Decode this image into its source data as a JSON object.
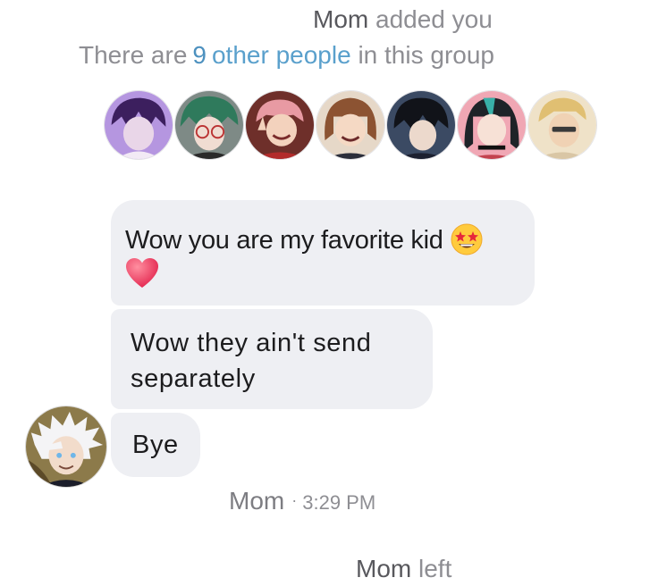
{
  "system_added": {
    "actor": "Mom",
    "action": "added you"
  },
  "group_info": {
    "prefix": "There are",
    "count": "9",
    "link": "other people",
    "suffix": "in this group"
  },
  "member_avatars": [
    {
      "icon": "purple-hair-character-avatar",
      "bg": "#8e5fc4"
    },
    {
      "icon": "green-hair-glasses-character-avatar",
      "bg": "#6d7d72"
    },
    {
      "icon": "pink-hair-peace-sign-character-avatar",
      "bg": "#b44a3c"
    },
    {
      "icon": "brown-hair-character-avatar",
      "bg": "#8b5e45"
    },
    {
      "icon": "black-hair-character-avatar",
      "bg": "#2f3a4c"
    },
    {
      "icon": "teal-hair-character-avatar",
      "bg": "#d9607a"
    },
    {
      "icon": "blonde-hair-character-avatar",
      "bg": "#e8c98e"
    }
  ],
  "messages": [
    {
      "text": "Wow you are my favorite kid",
      "emojis": [
        "star-struck-emoji",
        "heart-emoji"
      ]
    },
    {
      "text": "Wow they ain't send separately"
    },
    {
      "text": "Bye"
    }
  ],
  "sender": {
    "name": "Mom",
    "time": "3:29 PM",
    "separator": "·",
    "avatar_icon": "white-hair-character-avatar"
  },
  "system_left": {
    "actor": "Mom",
    "action": "left"
  }
}
